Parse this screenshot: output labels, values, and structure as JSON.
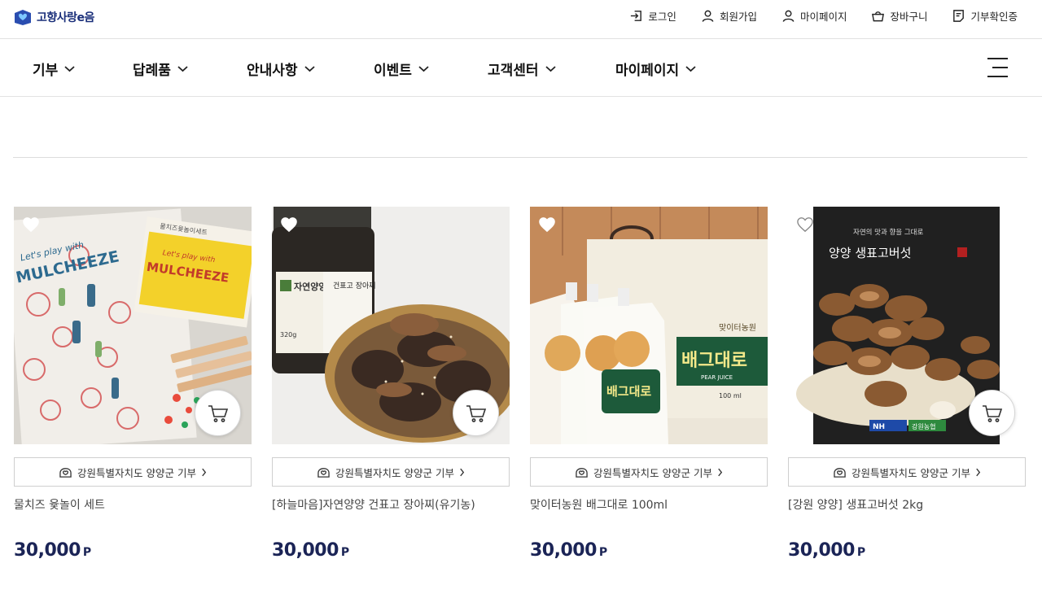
{
  "logo": {
    "text": "고향사랑e음"
  },
  "util_nav": [
    {
      "label": "로그인",
      "icon": "login-icon"
    },
    {
      "label": "회원가입",
      "icon": "user-icon"
    },
    {
      "label": "마이페이지",
      "icon": "user-icon"
    },
    {
      "label": "장바구니",
      "icon": "basket-icon"
    },
    {
      "label": "기부확인증",
      "icon": "receipt-icon"
    }
  ],
  "main_nav": [
    {
      "label": "기부"
    },
    {
      "label": "답례품"
    },
    {
      "label": "안내사항"
    },
    {
      "label": "이벤트"
    },
    {
      "label": "고객센터"
    },
    {
      "label": "마이페이지"
    }
  ],
  "products": [
    {
      "region": "강원특별자치도 양양군 기부",
      "title": "물치즈 윷놀이 세트",
      "price": "30,000",
      "unit": "P",
      "wished": true
    },
    {
      "region": "강원특별자치도 양양군 기부",
      "title": "[하늘마음]자연양양 건표고 장아찌(유기농)",
      "price": "30,000",
      "unit": "P",
      "wished": true
    },
    {
      "region": "강원특별자치도 양양군 기부",
      "title": "맞이터농원 배그대로 100ml",
      "price": "30,000",
      "unit": "P",
      "wished": true
    },
    {
      "region": "강원특별자치도 양양군 기부",
      "title": "[강원 양양] 생표고버섯 2kg",
      "price": "30,000",
      "unit": "P",
      "wished": false
    }
  ],
  "images": {
    "p1": {
      "box_line1": "물치즈윷놀이세트",
      "box_line2": "Let's play with",
      "box_line3": "MULCHEEZE"
    },
    "p2": {
      "jar_brand": "자연양양",
      "jar_name": "건표고 장아찌",
      "jar_weight": "320g"
    },
    "p3": {
      "box_brand": "맞이터농원",
      "box_name": "배그대로",
      "box_sub": "PEAR JUICE",
      "box_vol": "100 ml"
    },
    "p4": {
      "headline_small": "자연의 맛과 향을 그대로",
      "headline": "양양 생표고버섯",
      "badge1": "NH",
      "badge2": "강원농협"
    }
  },
  "colors": {
    "brand_navy": "#1b2456",
    "logo_blue": "#1a2f7a",
    "heart_fill": "#ffffff"
  }
}
